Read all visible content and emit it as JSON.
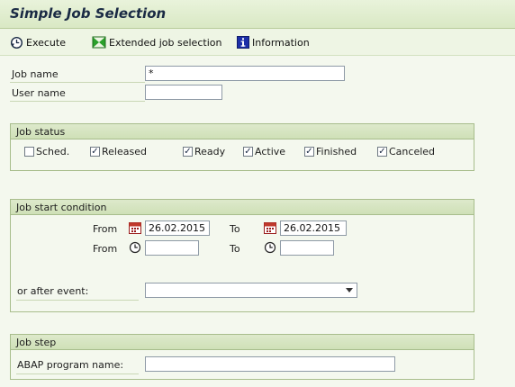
{
  "title": "Simple Job Selection",
  "toolbar": {
    "execute": "Execute",
    "extended": "Extended job selection",
    "information": "Information"
  },
  "fields": {
    "job_name_label": "Job name",
    "job_name_value": "*",
    "user_name_label": "User name",
    "user_name_value": ""
  },
  "job_status": {
    "header": "Job status",
    "items": [
      {
        "label": "Sched.",
        "checked": false
      },
      {
        "label": "Released",
        "checked": true
      },
      {
        "label": "Ready",
        "checked": true
      },
      {
        "label": "Active",
        "checked": true
      },
      {
        "label": "Finished",
        "checked": true
      },
      {
        "label": "Canceled",
        "checked": true
      }
    ]
  },
  "start_condition": {
    "header": "Job start condition",
    "from_label": "From",
    "to_label": "To",
    "from_date": "26.02.2015",
    "to_date": "26.02.2015",
    "from_time": "",
    "to_time": "",
    "event_label": "or after event:",
    "event_value": ""
  },
  "job_step": {
    "header": "Job step",
    "program_label": "ABAP program name:",
    "program_value": ""
  },
  "colors": {
    "title_text": "#1a2a44",
    "group_border": "#a8bd8c",
    "execute_icon": "#1a2a44",
    "extended_icon": "#2aa02a",
    "info_icon": "#1c2fa8"
  },
  "icons": {
    "execute": "execute-clock-icon",
    "extended": "extended-selection-icon",
    "information": "information-icon",
    "date": "calendar-icon",
    "time": "clock-icon"
  }
}
